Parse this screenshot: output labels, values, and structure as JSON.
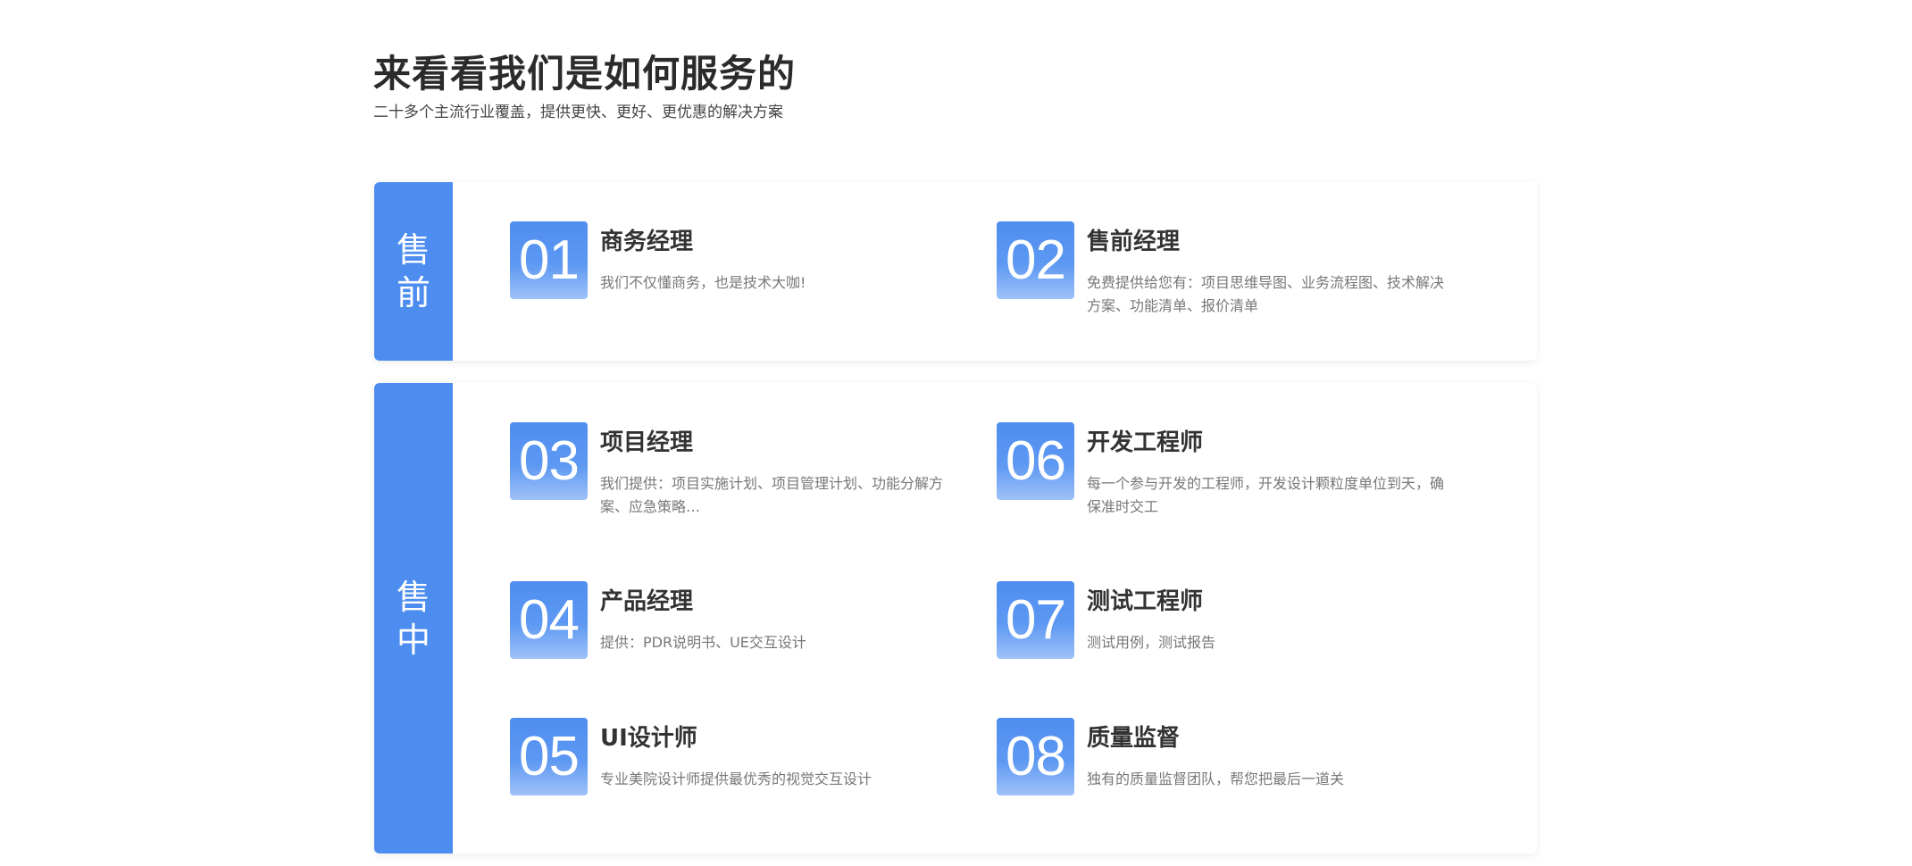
{
  "header": {
    "title": "来看看我们是如何服务的",
    "subtitle": "二十多个主流行业覆盖，提供更快、更好、更优惠的解决方案"
  },
  "presale": {
    "label": "售前",
    "cards": [
      {
        "num": "01",
        "title": "商务经理",
        "desc": "我们不仅懂商务，也是技术大咖!"
      },
      {
        "num": "02",
        "title": "售前经理",
        "desc": "免费提供给您有：项目思维导图、业务流程图、技术解决方案、功能清单、报价清单"
      }
    ]
  },
  "insale": {
    "label": "售中",
    "cards": [
      {
        "num": "03",
        "title": "项目经理",
        "desc": "我们提供：项目实施计划、项目管理计划、功能分解方案、应急策略…"
      },
      {
        "num": "06",
        "title": "开发工程师",
        "desc": "每一个参与开发的工程师，开发设计颗粒度单位到天，确保准时交工"
      },
      {
        "num": "04",
        "title": "产品经理",
        "desc": "提供：PDR说明书、UE交互设计"
      },
      {
        "num": "07",
        "title": "测试工程师",
        "desc": "测试用例，测试报告"
      },
      {
        "num": "05",
        "title": "UI设计师",
        "desc": "专业美院设计师提供最优秀的视觉交互设计"
      },
      {
        "num": "08",
        "title": "质量监督",
        "desc": "独有的质量监督团队，帮您把最后一道关"
      }
    ]
  },
  "colors": {
    "accent": "#4d8def",
    "title_text": "#2b2b2b",
    "desc_text": "#777777"
  }
}
